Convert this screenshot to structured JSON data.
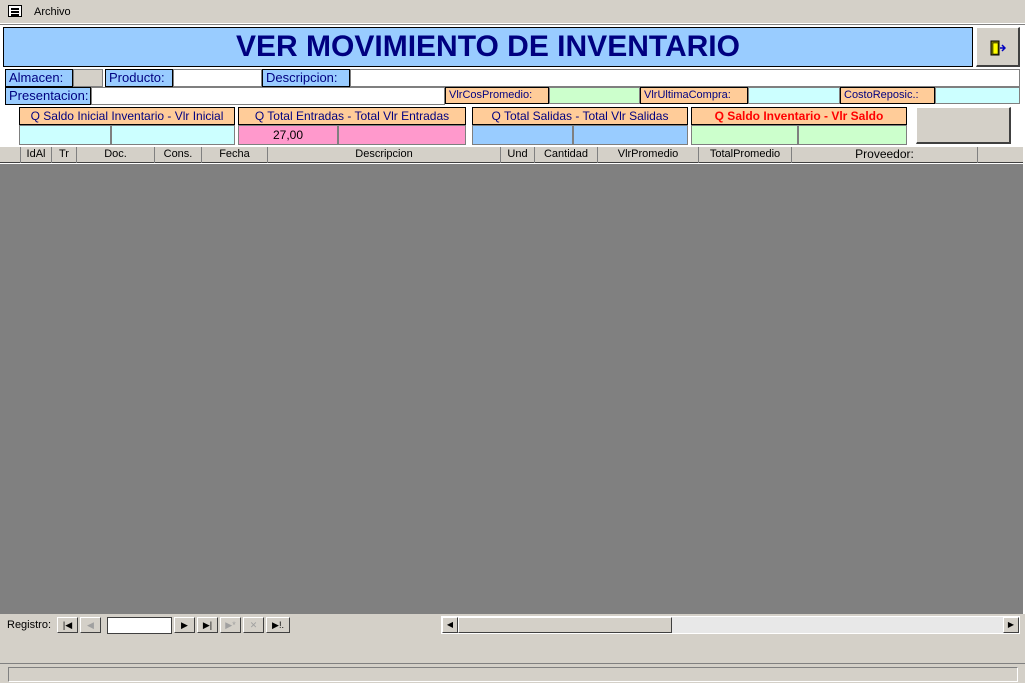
{
  "menu": {
    "archivo": "Archivo"
  },
  "form": {
    "title": "VER MOVIMIENTO DE INVENTARIO",
    "labels": {
      "almacen": "Almacen:",
      "producto": "Producto:",
      "descripcion": "Descripcion:",
      "presentacion": "Presentacion:",
      "vlr_cos_promedio": "VlrCosPromedio:",
      "vlr_ultima_compra": "VlrUltimaCompra:",
      "costo_reposic": "CostoReposic.:"
    },
    "summaries": {
      "saldo_inicial": {
        "label": "Q Saldo Inicial Inventario - Vlr Inicial",
        "qty": "",
        "value": ""
      },
      "total_entradas": {
        "label": "Q Total Entradas - Total Vlr Entradas",
        "qty": "27,00",
        "value": ""
      },
      "total_salidas": {
        "label": "Q Total Salidas - Total Vlr Salidas",
        "qty": "",
        "value": ""
      },
      "saldo_inventario": {
        "label": "Q Saldo Inventario  - Vlr Saldo",
        "qty": "",
        "value": ""
      }
    }
  },
  "grid": {
    "columns": [
      "IdAl",
      "Tr",
      "Doc.",
      "Cons.",
      "Fecha",
      "Descripcion",
      "Und",
      "Cantidad",
      "VlrPromedio",
      "TotalPromedio",
      "Proveedor:"
    ]
  },
  "navigation": {
    "label": "Registro:",
    "record_value": ""
  },
  "colors": {
    "title_bg": "#99ccff",
    "title_text": "#000080",
    "label_orange": "#ffcc99",
    "field_cyan": "#ccffff",
    "field_pink": "#ff99cc",
    "field_green": "#ccffcc",
    "grid_bg": "#808080"
  }
}
